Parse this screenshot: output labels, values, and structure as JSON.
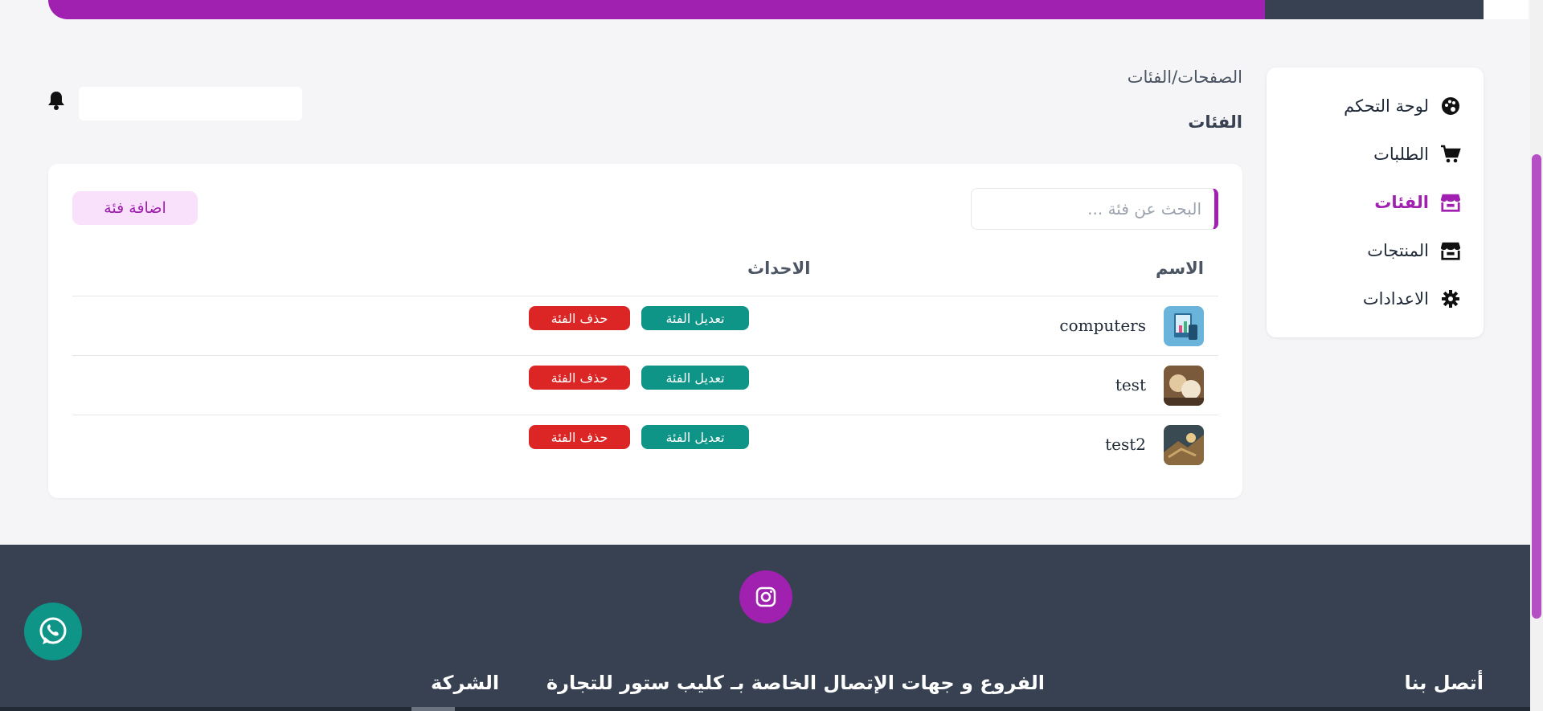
{
  "sidebar": {
    "items": [
      {
        "label": "لوحة التحكم",
        "icon": "palette-icon"
      },
      {
        "label": "الطلبات",
        "icon": "cart-icon"
      },
      {
        "label": "الفئات",
        "icon": "store-icon",
        "active": true
      },
      {
        "label": "المنتجات",
        "icon": "store-icon"
      },
      {
        "label": "الاعدادات",
        "icon": "gear-icon"
      }
    ]
  },
  "header": {
    "breadcrumb": "الصفحات/الفئات",
    "title": "الفئات"
  },
  "card": {
    "search_placeholder": "البحث عن فئة ...",
    "add_button": "اضافة فئة",
    "columns": {
      "name": "الاسم",
      "actions": "الاحداث"
    },
    "rows": [
      {
        "name": "computers",
        "edit": "تعديل الفئة",
        "delete": "حذف الفئة"
      },
      {
        "name": "test",
        "edit": "تعديل الفئة",
        "delete": "حذف الفئة"
      },
      {
        "name": "test2",
        "edit": "تعديل الفئة",
        "delete": "حذف الفئة"
      }
    ]
  },
  "footer": {
    "contact_heading": "أتصل بنا",
    "branches_heading": "الفروع و جهات الإتصال الخاصة بـ كليب ستور للتجارة",
    "company_heading": "الشركة"
  },
  "colors": {
    "accent": "#a020b0",
    "teal": "#0f9488",
    "danger": "#dc2626",
    "footer": "#374151"
  }
}
